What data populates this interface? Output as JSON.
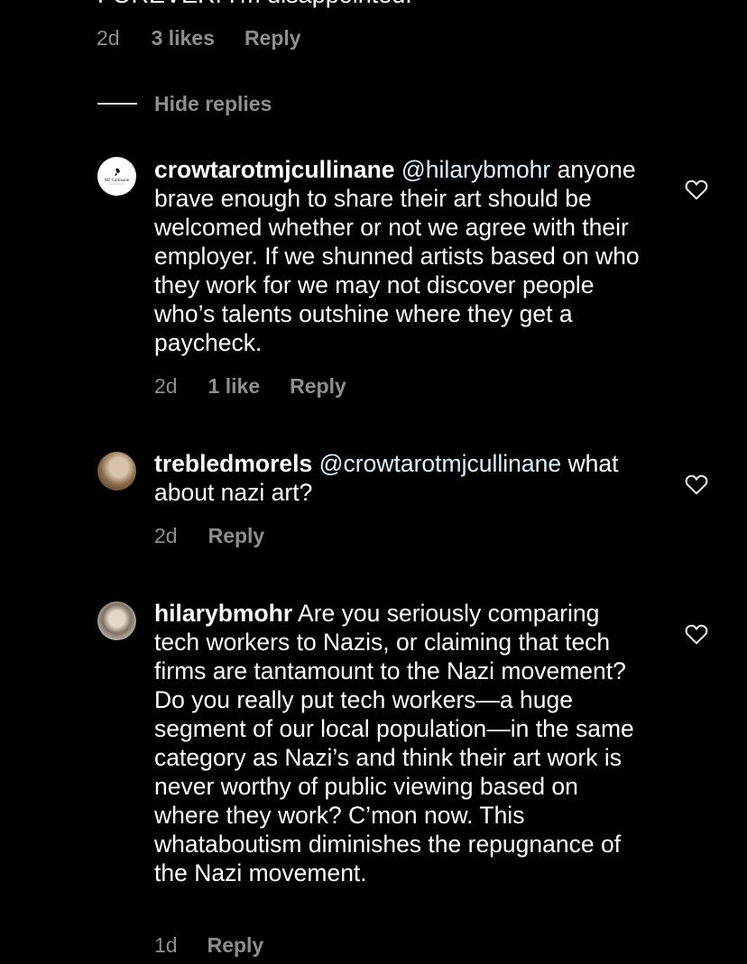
{
  "previous_comment": {
    "cut_text": "FOREVER. I'm disappointed.",
    "time": "2d",
    "likes": "3 likes",
    "reply_label": "Reply"
  },
  "replies_toggle": {
    "label": "Hide replies"
  },
  "comments": [
    {
      "username": "crowtarotmjcullinane",
      "mention": "@hilarybmohr",
      "text": "anyone brave enough to share their art should be welcomed whether or not we agree with their employer. If we shunned artists based on who they work for we may not discover people who’s talents outshine where they get a paycheck.",
      "time": "2d",
      "likes": "1 like",
      "reply_label": "Reply",
      "avatar_text": "MJ Cullinane"
    },
    {
      "username": "trebledmorels",
      "mention": "@crowtarotmjcullinane",
      "text": "what about nazi art?",
      "time": "2d",
      "reply_label": "Reply"
    },
    {
      "username": "hilarybmohr",
      "text": "Are you seriously comparing tech workers to Nazis, or claiming that tech firms are tantamount to the Nazi movement? Do you really put tech workers—a huge segment of our local population—in the same category as Nazi’s and think their art work is never worthy of public viewing based on where they work? C’mon now. This whataboutism diminishes the repugnance of the Nazi movement.",
      "time": "1d",
      "reply_label": "Reply"
    }
  ],
  "colors": {
    "background": "#000000",
    "text": "#ffffff",
    "secondary": "#8e8e8e",
    "mention": "#e0f1ff"
  },
  "icons": [
    "heart-icon"
  ]
}
